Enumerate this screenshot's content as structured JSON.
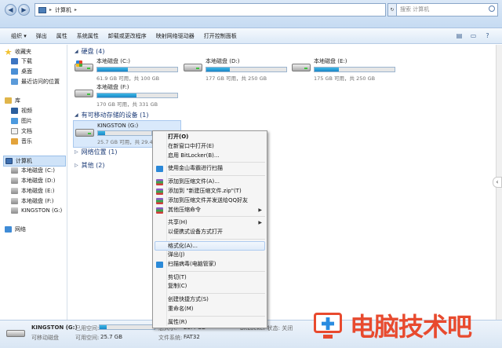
{
  "address": {
    "crumbs": [
      "计算机"
    ]
  },
  "search": {
    "placeholder": "搜索 计算机"
  },
  "toolbar": {
    "items": [
      "组织 ▾",
      "弹出",
      "属性",
      "系统属性",
      "卸载或更改程序",
      "映射网络驱动器",
      "打开控制面板"
    ]
  },
  "sidebar": {
    "favorites": "收藏夹",
    "fav_items": [
      "下载",
      "桌面",
      "最近访问的位置"
    ],
    "library": "库",
    "lib_items": [
      "视频",
      "图片",
      "文档",
      "音乐"
    ],
    "computer": "计算机",
    "pc_items": [
      "本地磁盘 (C:)",
      "本地磁盘 (D:)",
      "本地磁盘 (E:)",
      "本地磁盘 (F:)",
      "KINGSTON (G:)"
    ],
    "network": "网络"
  },
  "groups": {
    "hdd": "硬盘 (4)",
    "removable": "有可移动存储的设备 (1)",
    "netloc": "网络位置 (1)",
    "other": "其他 (2)"
  },
  "drives": [
    {
      "name": "本地磁盘 (C:)",
      "free": "61.9 GB 可用，共 100 GB",
      "used": 0.38
    },
    {
      "name": "本地磁盘 (D:)",
      "free": "177 GB 可用，共 250 GB",
      "used": 0.29
    },
    {
      "name": "本地磁盘 (E:)",
      "free": "175 GB 可用，共 250 GB",
      "used": 0.3
    },
    {
      "name": "本地磁盘 (F:)",
      "free": "170 GB 可用，共 331 GB",
      "used": 0.49
    }
  ],
  "usb": {
    "name": "KINGSTON (G:)",
    "free": "25.7 GB 可用，共 29.4",
    "used": 0.13
  },
  "menu": {
    "items": [
      "打开(O)",
      "在新窗口中打开(E)",
      "启用 BitLocker(B)...",
      "使用金山毒霸进行扫描",
      "添加到压缩文件(A)...",
      "添加到 \"新建压缩文件.zip\"(T)",
      "添加到压缩文件并发送给QQ好友",
      "其他压缩命令",
      "共享(H)",
      "以便携式设备方式打开",
      "格式化(A)...",
      "弹出(J)",
      "扫描病毒(电脑管家)",
      "剪切(T)",
      "复制(C)",
      "创建快捷方式(S)",
      "重命名(M)",
      "属性(R)"
    ]
  },
  "status": {
    "name": "KINGSTON (G:)",
    "type": "可移动磁盘",
    "used_label": "已用空间:",
    "free_label": "可用空间:",
    "free_value": "25.7 GB",
    "total_label": "总大小:",
    "total_value": "29.4 GB",
    "fs_label": "文件系统:",
    "fs_value": "FAT32",
    "bitlocker": "BitLocker 状态: 关闭",
    "used_fraction": 0.13
  },
  "watermark": "电脑技术吧",
  "colors": {
    "accent": "#1b86c6",
    "watermark": "#e84a2e"
  }
}
